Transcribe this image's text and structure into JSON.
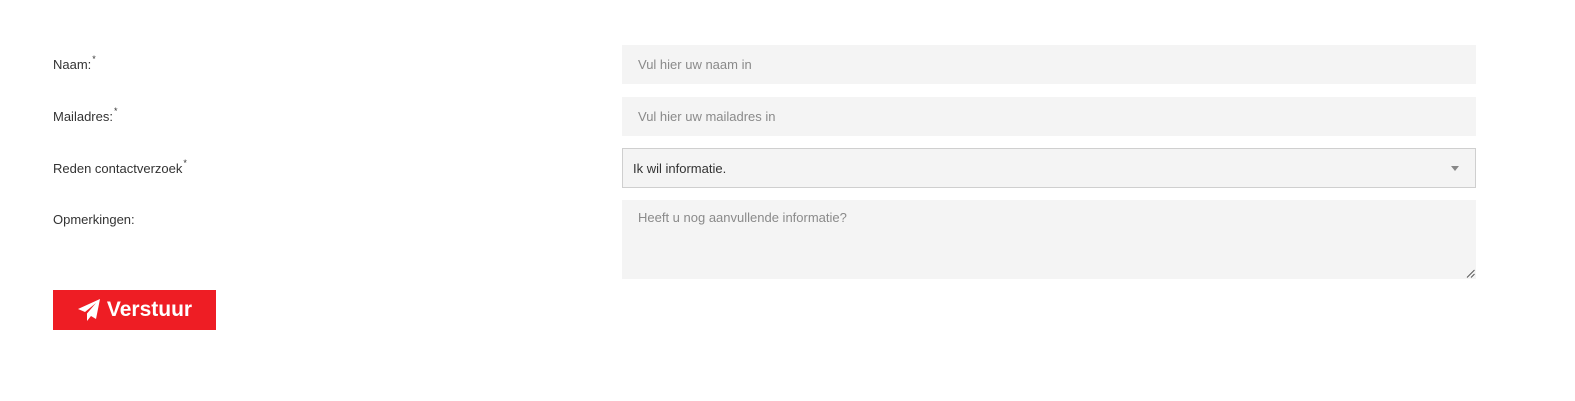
{
  "form": {
    "name": {
      "label": "Naam:",
      "required_mark": "*",
      "placeholder": "Vul hier uw naam in"
    },
    "email": {
      "label": "Mailadres:",
      "required_mark": "*",
      "placeholder": "Vul hier uw mailadres in"
    },
    "reason": {
      "label": "Reden contactverzoek",
      "required_mark": "*",
      "selected": "Ik wil informatie."
    },
    "remarks": {
      "label": "Opmerkingen:",
      "placeholder": "Heeft u nog aanvullende informatie?"
    },
    "submit": {
      "label": "Verstuur",
      "icon": "paper-plane-icon"
    }
  },
  "colors": {
    "accent": "#ee1d24",
    "field_bg": "#f4f4f4",
    "text": "#333333",
    "placeholder": "#8a8a8a"
  }
}
